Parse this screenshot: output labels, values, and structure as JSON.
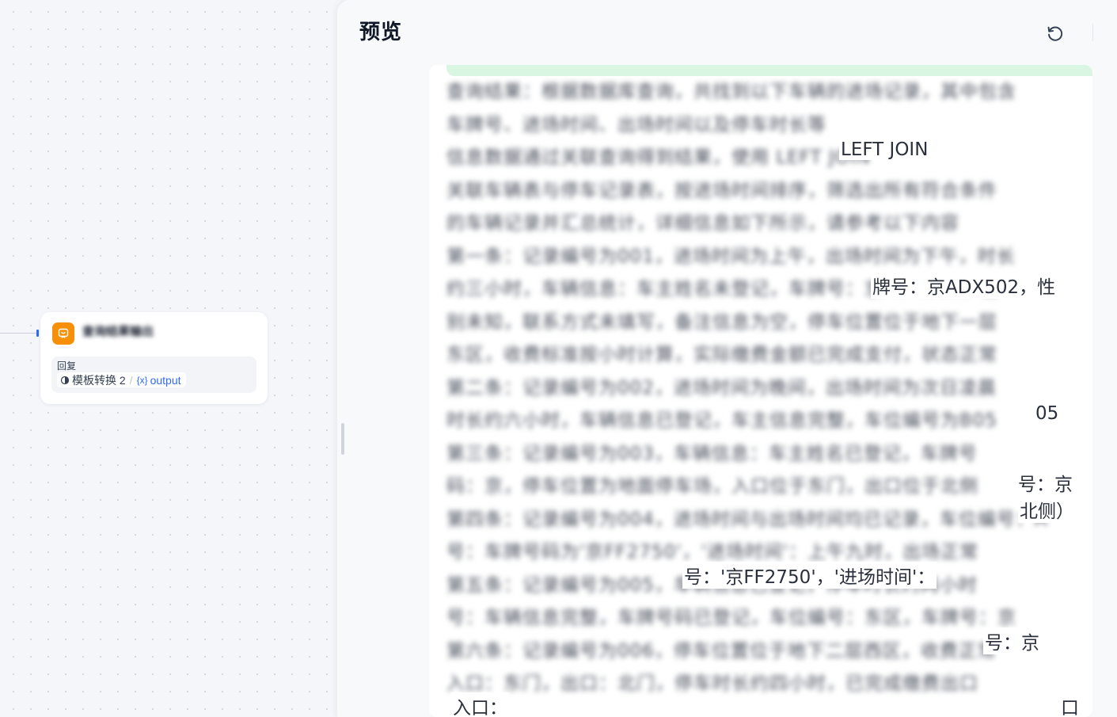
{
  "workflow": {
    "node": {
      "title": "查询结果输出",
      "reply_label": "回复",
      "variable": {
        "source_node": "模板转换 2",
        "separator": "/",
        "var_icon_text": "{x}",
        "var_name": "output"
      },
      "icon": "reply-bubble-icon",
      "icon_color": "#f79009"
    },
    "accent_color": "#2f6bf3"
  },
  "preview": {
    "title": "预览",
    "refresh_icon": "refresh-icon",
    "result_lines": [
      "查询结果：根据数据库查询，共找到以下车辆的进场记录，其中包含",
      "车牌号、进场时间、出场时间以及停车时长等",
      "信息数据通过关联查询得到结果，使用 LEFT JOIN",
      "关联车辆表与停车记录表，按进场时间排序，筛选出所有符合条件",
      "的车辆记录并汇总统计，详细信息如下所示，请参考以下内容",
      "第一条：记录编号为001，进场时间为上午，出场时间为下午，时长",
      "约三小时，车辆信息：车主姓名未登记，车牌号：京ADX502，性",
      "别未知，联系方式未填写，备注信息为空，停车位置位于地下一层",
      "东区，收费标准按小时计算，实际缴费金额已完成支付，状态正常",
      "第二条：记录编号为002，进场时间为晚间，出场时间为次日凌晨",
      "时长约六小时，车辆信息已登记，车主信息完整，车位编号为B05",
      "第三条：记录编号为003，车辆信息：车主姓名已登记，车牌号",
      "码：京，停车位置为地面停车场，入口位于东门，出口位于北侧",
      "第四条：记录编号为004，进场时间与出场时间均已记录，车位编号：A",
      "号：车牌号码为'京FF2750'，'进场时间'：上午九时，出场正常",
      "第五条：记录编号为005，车辆信息已登记，停车时长约两小时",
      "号：车辆信息完整，车牌号码已登记，车位编号：东区，车牌号：京",
      "第六条：记录编号为006，停车位置位于地下二层西区，收费正常",
      "入口：东门，出口：北门，停车时长约四小时，已完成缴费出口"
    ],
    "visible_fragments": [
      "LEFT JOIN",
      "牌号：京ADX502，性",
      "05",
      "号：京",
      "北侧）",
      "号：'京FF2750'，'进场时间'：",
      "号：京",
      "入口：",
      "口"
    ]
  }
}
